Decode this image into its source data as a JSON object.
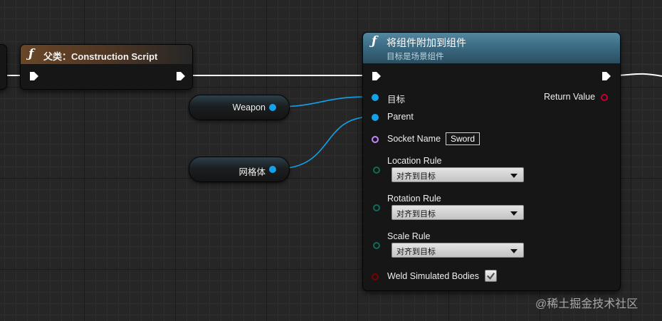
{
  "construction_node": {
    "title": "父类：Construction Script",
    "icon": "function-icon",
    "header_color": "#5f4025"
  },
  "weapon_node": {
    "label": "Weapon"
  },
  "mesh_node": {
    "label": "网格体"
  },
  "attach_node": {
    "title": "将组件附加到组件",
    "subtitle": "目标是场景组件",
    "icon": "function-icon",
    "header_color": "#3a6d84",
    "target_label": "目标",
    "return_label": "Return Value",
    "parent_label": "Parent",
    "socket_label": "Socket Name",
    "socket_value": "Sword",
    "location_rule_label": "Location Rule",
    "location_rule_value": "对齐到目标",
    "rotation_rule_label": "Rotation Rule",
    "rotation_rule_value": "对齐到目标",
    "scale_rule_label": "Scale Rule",
    "scale_rule_value": "对齐到目标",
    "weld_label": "Weld Simulated Bodies",
    "weld_checked": true
  },
  "colors": {
    "object_pin": "#13a1ea",
    "name_pin": "#c486ff",
    "enum_pin": "#0e6b59",
    "bool_pin": "#7e0000",
    "exec_wire": "#ffffff"
  },
  "watermark": "@稀土掘金技术社区"
}
